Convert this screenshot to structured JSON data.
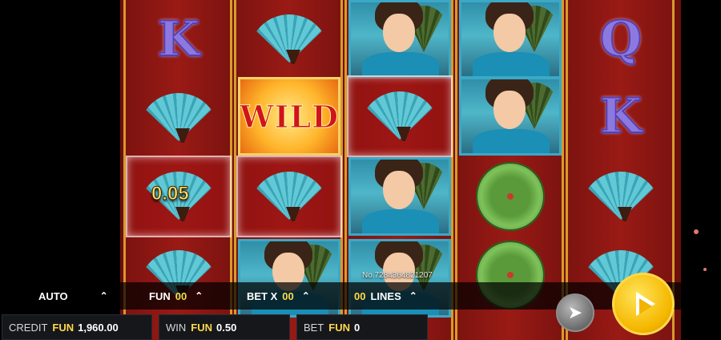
{
  "win_labels": {
    "fan_win": "0.05"
  },
  "serial": "No.7284364821207",
  "symbols": {
    "wild": "WILD",
    "k": "K",
    "q": "Q"
  },
  "controls": {
    "auto": "AUTO",
    "fun_label": "FUN",
    "fun_value": "00",
    "bet_x_label": "BET X",
    "bet_x_value": "00",
    "lines_value": "00",
    "lines_label": "LINES"
  },
  "status": {
    "credit_label": "CREDIT",
    "credit_currency": "FUN",
    "credit_amount": "1,960.00",
    "win_label": "WIN",
    "win_currency": "FUN",
    "win_amount": "0.50",
    "bet_label": "BET",
    "bet_currency": "FUN",
    "bet_amount": "0"
  },
  "icons": {
    "auto_chevron": "chevron-up-icon",
    "turbo": "rabbit-icon",
    "spin": "play-icon"
  },
  "colors": {
    "reel_red": "#9a1a15",
    "gold_border": "#d89a2a",
    "accent_yellow": "#ffd84a",
    "spin_yellow": "#f5b800"
  }
}
